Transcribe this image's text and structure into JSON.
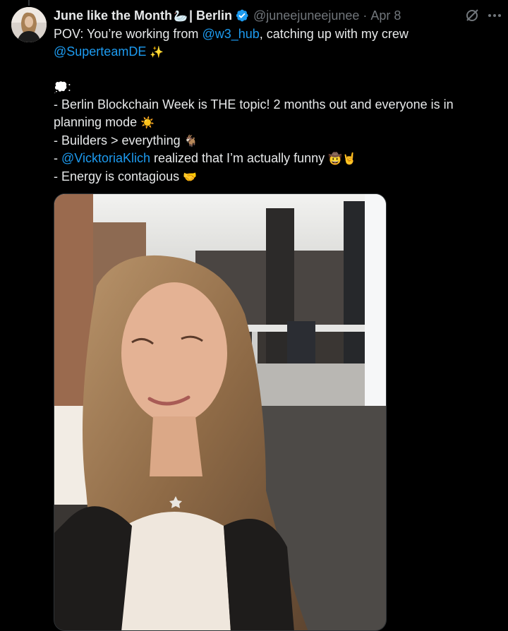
{
  "tweet": {
    "display_name": "June like the Month",
    "name_emoji": "🦢",
    "name_suffix": "| Berlin",
    "handle": "@juneejuneejunee",
    "separator": "·",
    "timestamp": "Apr 8",
    "lines": {
      "l1_pre": "POV: You’re working from ",
      "l1_link": "@w3_hub",
      "l1_post": ", catching up with my crew",
      "l2_link": "@SuperteamDE",
      "l2_emoji": "✨",
      "l3_emoji": "💭",
      "l3_text": ":",
      "l4_text": "- Berlin Blockchain Week is THE topic! 2 months out and everyone is in planning mode",
      "l4_emoji": "☀️",
      "l5_text": "- Builders > everything",
      "l5_emoji": "🐐",
      "l6_pre": "- ",
      "l6_link": "@VicktoriaKlich",
      "l6_post": " realized that I’m actually funny",
      "l6_emoji": "🤠🤘",
      "l7_text": "- Energy is contagious",
      "l7_emoji": "🤝"
    }
  },
  "colors": {
    "background": "#000000",
    "text": "#e7e9ea",
    "secondary": "#71767b",
    "link": "#1d9bf0",
    "verified": "#1d9bf0"
  },
  "icons": [
    "verified-badge-icon",
    "grok-icon",
    "more-options-icon"
  ]
}
